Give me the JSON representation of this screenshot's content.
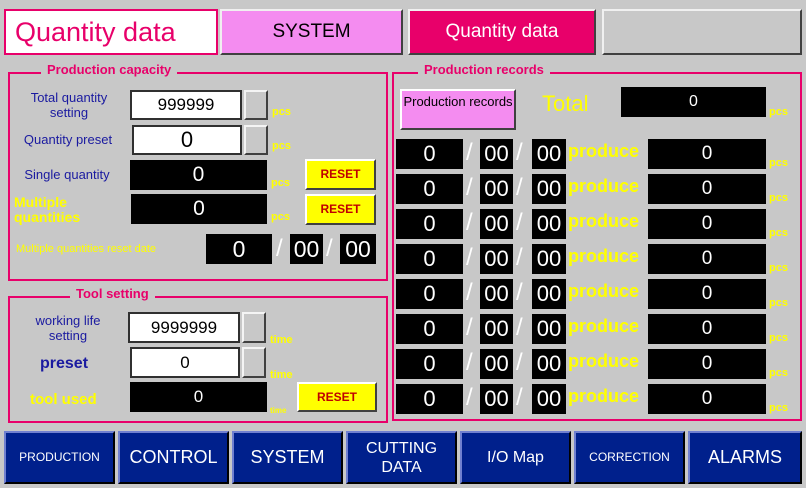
{
  "header": {
    "title": "Quantity data",
    "system_tab": "SYSTEM",
    "quantity_tab": "Quantity data"
  },
  "capacity": {
    "legend": "Production capacity",
    "total_label": "Total quantity setting",
    "total_value": "999999",
    "total_unit": "pcs",
    "preset_label": "Quantity preset",
    "preset_value": "0",
    "preset_unit": "pcs",
    "single_label": "Single quantity",
    "single_value": "0",
    "single_unit": "pcs",
    "single_reset": "RESET",
    "multiple_label": "Multiple quantities",
    "multiple_value": "0",
    "multiple_unit": "pcs",
    "multiple_reset": "RESET",
    "reset_date_label": "Multiple quantities reset date",
    "reset_date": {
      "d1": "0",
      "d2": "00",
      "d3": "00",
      "sep": "/"
    }
  },
  "tool": {
    "legend": "Tool setting",
    "life_label": "working life setting",
    "life_value": "9999999",
    "life_unit": "time",
    "preset_label": "preset",
    "preset_value": "0",
    "preset_unit": "time",
    "used_label": "tool used",
    "used_value": "0",
    "used_unit": "time",
    "reset": "RESET"
  },
  "records": {
    "legend": "Production records",
    "button": "Production records",
    "total_label": "Total",
    "total_value": "0",
    "total_unit": "pcs",
    "rows": [
      {
        "d1": "0",
        "d2": "00",
        "d3": "00",
        "label": "produce",
        "value": "0",
        "unit": "pcs"
      },
      {
        "d1": "0",
        "d2": "00",
        "d3": "00",
        "label": "produce",
        "value": "0",
        "unit": "pcs"
      },
      {
        "d1": "0",
        "d2": "00",
        "d3": "00",
        "label": "produce",
        "value": "0",
        "unit": "pcs"
      },
      {
        "d1": "0",
        "d2": "00",
        "d3": "00",
        "label": "produce",
        "value": "0",
        "unit": "pcs"
      },
      {
        "d1": "0",
        "d2": "00",
        "d3": "00",
        "label": "produce",
        "value": "0",
        "unit": "pcs"
      },
      {
        "d1": "0",
        "d2": "00",
        "d3": "00",
        "label": "produce",
        "value": "0",
        "unit": "pcs"
      },
      {
        "d1": "0",
        "d2": "00",
        "d3": "00",
        "label": "produce",
        "value": "0",
        "unit": "pcs"
      },
      {
        "d1": "0",
        "d2": "00",
        "d3": "00",
        "label": "produce",
        "value": "0",
        "unit": "pcs"
      }
    ]
  },
  "nav": {
    "production": "PRODUCTION",
    "control": "CONTROL",
    "system": "SYSTEM",
    "cutting": "CUTTING DATA",
    "io": "I/O Map",
    "correction": "CORRECTION",
    "alarms": "ALARMS"
  },
  "colors": {
    "accent": "#e8006a",
    "pink": "#f48cf0",
    "label_yellow": "#ffff00",
    "nav_blue": "#00208c"
  }
}
